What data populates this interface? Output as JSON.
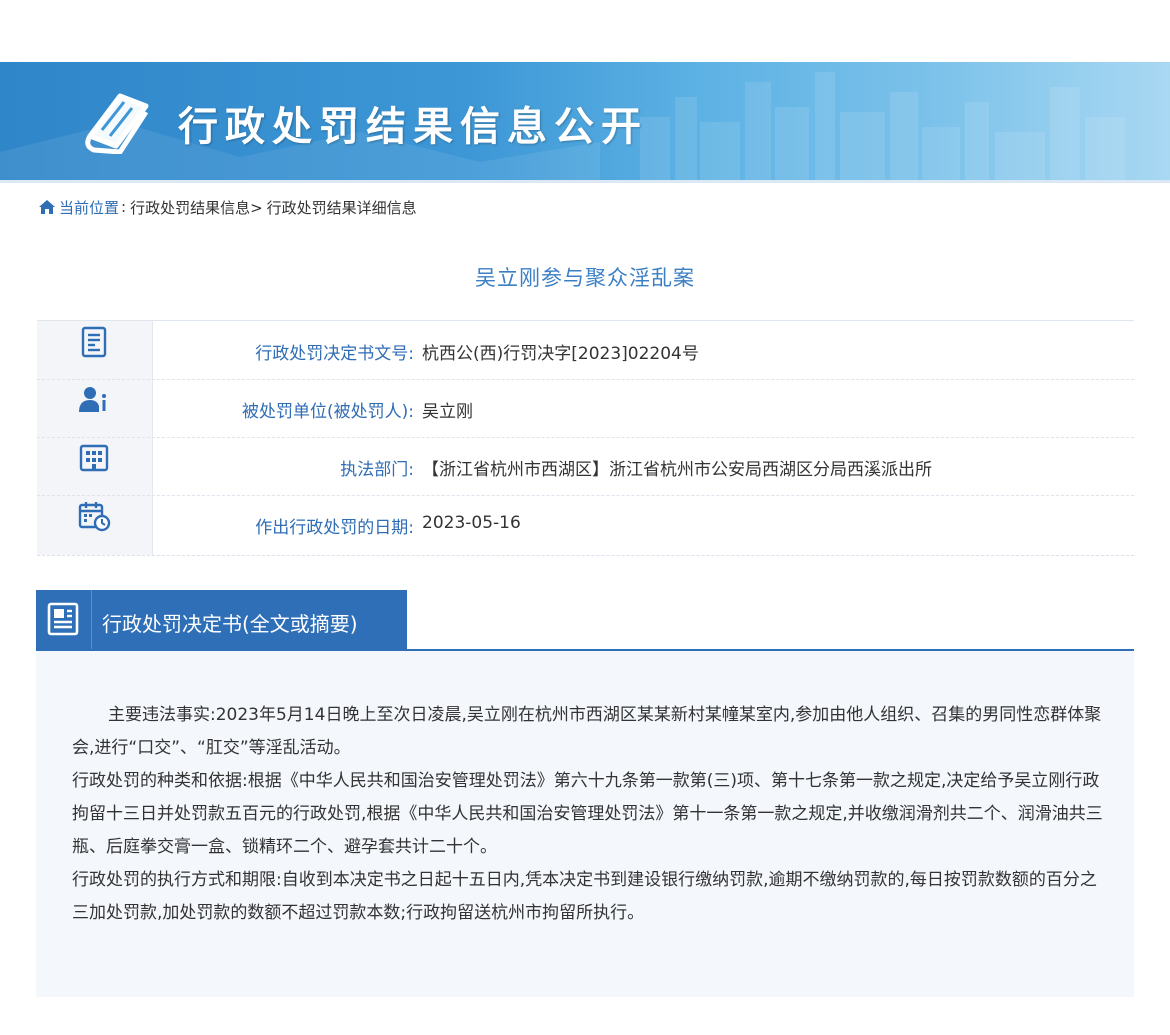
{
  "banner": {
    "title": "行政处罚结果信息公开",
    "icon": "book-icon"
  },
  "breadcrumb": {
    "icon": "home-icon",
    "current_label": "当前位置",
    "separator": ":",
    "items": [
      "行政处罚结果信息>",
      "行政处罚结果详细信息"
    ]
  },
  "case": {
    "title": "吴立刚参与聚众淫乱案"
  },
  "info": {
    "rows": [
      {
        "icon": "document-icon",
        "label": "行政处罚决定书文号:",
        "value": "杭西公(西)行罚决字[2023]02204号"
      },
      {
        "icon": "person-info-icon",
        "label": "被处罚单位(被处罚人):",
        "value": "吴立刚"
      },
      {
        "icon": "building-icon",
        "label": "执法部门:",
        "value": "【浙江省杭州市西湖区】浙江省杭州市公安局西湖区分局西溪派出所"
      },
      {
        "icon": "calendar-clock-icon",
        "label": "作出行政处罚的日期:",
        "value": "2023-05-16"
      }
    ]
  },
  "decision": {
    "tab_label": "行政处罚决定书(全文或摘要)",
    "tab_icon": "newspaper-icon",
    "paragraphs": [
      "主要违法事实:2023年5月14日晚上至次日凌晨,吴立刚在杭州市西湖区某某新村某幢某室内,参加由他人组织、召集的男同性恋群体聚会,进行“口交”、“肛交”等淫乱活动。",
      "行政处罚的种类和依据:根据《中华人民共和国治安管理处罚法》第六十九条第一款第(三)项、第十七条第一款之规定,决定给予吴立刚行政拘留十三日并处罚款五百元的行政处罚,根据《中华人民共和国治安管理处罚法》第十一条第一款之规定,并收缴润滑剂共二个、润滑油共三瓶、后庭拳交膏一盒、锁精环二个、避孕套共计二十个。",
      "行政处罚的执行方式和期限:自收到本决定书之日起十五日内,凭本决定书到建设银行缴纳罚款,逾期不缴纳罚款的,每日按罚款数额的百分之三加处罚款,加处罚款的数额不超过罚款本数;行政拘留送杭州市拘留所执行。"
    ]
  },
  "colors": {
    "accent": "#2e6fb7",
    "label_blue": "#2f6db5",
    "title_blue": "#3b7fc4",
    "content_bg": "#f4f7fc"
  }
}
